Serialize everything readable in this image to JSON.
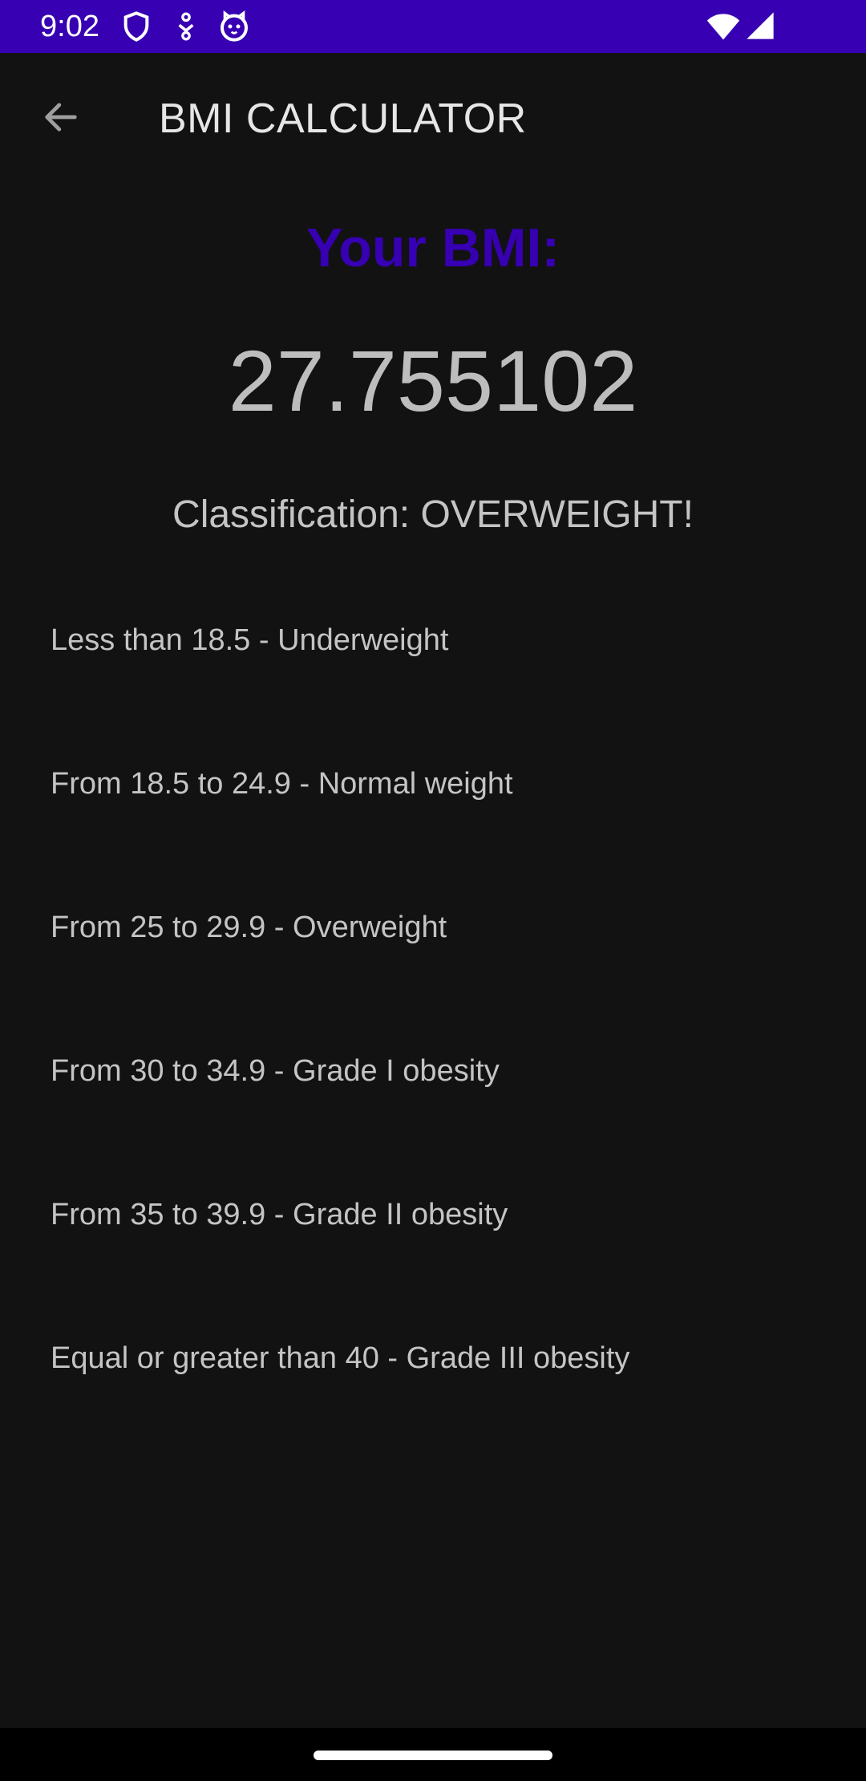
{
  "status_bar": {
    "time": "9:02",
    "icons": [
      "shield-icon",
      "download-icon",
      "cat-icon",
      "wifi-icon",
      "signal-icon"
    ],
    "background": "#3700B3"
  },
  "app_bar": {
    "title": "BMI CALCULATOR",
    "back_icon": "arrow-back-icon"
  },
  "result": {
    "heading": "Your BMI:",
    "value": "27.755102",
    "classification": "Classification: OVERWEIGHT!"
  },
  "ranges": [
    "Less than 18.5 - Underweight",
    "From 18.5 to 24.9 - Normal weight",
    "From 25 to 29.9 - Overweight",
    "From 30 to 34.9 - Grade I obesity",
    "From 35 to 39.9 - Grade II obesity",
    "Equal or greater than 40 - Grade III obesity"
  ],
  "colors": {
    "accent": "#3700B3",
    "background": "#121212",
    "text": "#c4c4c4"
  }
}
